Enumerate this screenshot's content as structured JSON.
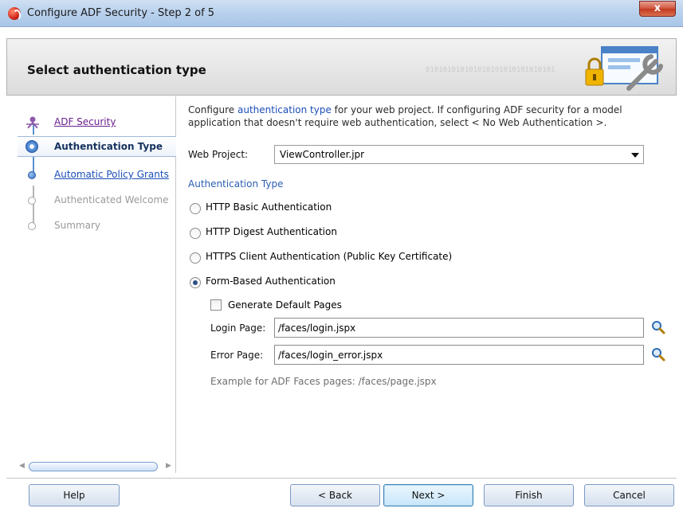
{
  "window": {
    "title": "Configure ADF Security - Step 2 of 5",
    "close_label": "x"
  },
  "header": {
    "title": "Select authentication type",
    "binary_text": "010101010101010101010101010101"
  },
  "nav": {
    "items": [
      {
        "label": "ADF Security",
        "state": "visited"
      },
      {
        "label": "Authentication Type",
        "state": "current"
      },
      {
        "label": "Automatic Policy Grants",
        "state": "link"
      },
      {
        "label": "Authenticated Welcome",
        "state": "disabled"
      },
      {
        "label": "Summary",
        "state": "disabled"
      }
    ]
  },
  "content": {
    "intro_before": "Configure ",
    "intro_link": "authentication type",
    "intro_after": " for your web project. If configuring ADF security for a model application that doesn't require web authentication, select < No Web Authentication >.",
    "web_project_label": "Web Project:",
    "web_project_value": "ViewController.jpr",
    "auth_type_heading": "Authentication Type",
    "radios": [
      {
        "label": "HTTP Basic Authentication",
        "checked": false
      },
      {
        "label": "HTTP Digest Authentication",
        "checked": false
      },
      {
        "label": "HTTPS Client Authentication (Public Key Certificate)",
        "checked": false
      },
      {
        "label": "Form-Based Authentication",
        "checked": true
      }
    ],
    "generate_default_pages_label": "Generate Default Pages",
    "generate_default_pages_checked": false,
    "login_page_label": "Login Page:",
    "login_page_value": "/faces/login.jspx",
    "error_page_label": "Error Page:",
    "error_page_value": "/faces/login_error.jspx",
    "hint": "Example for ADF Faces pages: /faces/page.jspx"
  },
  "footer": {
    "help": "Help",
    "back": "< Back",
    "next": "Next >",
    "finish": "Finish",
    "cancel": "Cancel"
  },
  "icons": [
    "oracle-app-icon",
    "close-icon",
    "security-wizard-graphic",
    "search-icon",
    "search-icon"
  ],
  "colors": {
    "link": "#1c4fb8",
    "visited": "#6b1f8e",
    "section_heading": "#2b5fb0",
    "nav_accent": "#3b74c4"
  }
}
